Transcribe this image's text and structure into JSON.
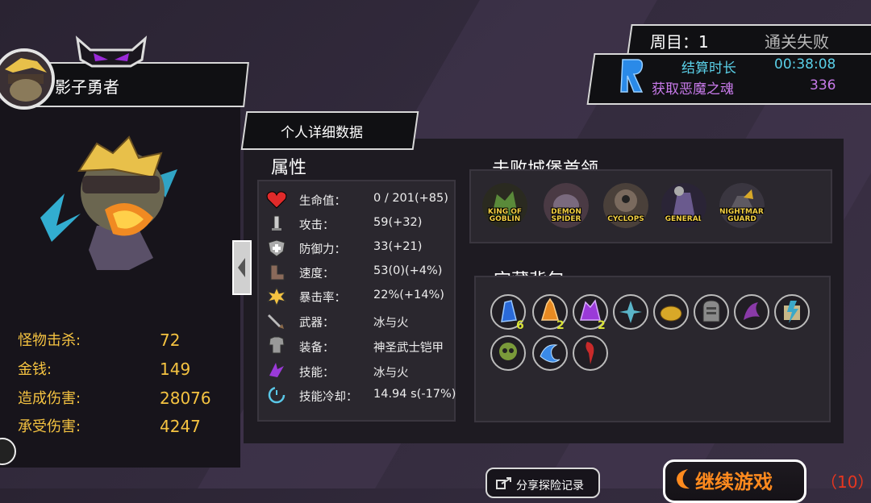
{
  "hero": {
    "name": "影子勇者",
    "stats": [
      {
        "label": "怪物击杀:",
        "value": "72"
      },
      {
        "label": "金钱:",
        "value": "149"
      },
      {
        "label": "造成伤害:",
        "value": "28076"
      },
      {
        "label": "承受伤害:",
        "value": "4247"
      }
    ]
  },
  "detail_tab": "个人详细数据",
  "attributes": {
    "title": "属性",
    "rows": [
      {
        "icon": "heart-icon",
        "label": "生命值：",
        "value": "0 / 201(+85)"
      },
      {
        "icon": "sword-icon",
        "label": "攻击：",
        "value": "59(+32)"
      },
      {
        "icon": "shield-icon",
        "label": "防御力：",
        "value": "33(+21)"
      },
      {
        "icon": "boot-icon",
        "label": "速度：",
        "value": "53(0)(+4%)"
      },
      {
        "icon": "burst-icon",
        "label": "暴击率：",
        "value": "22%(+14%)"
      },
      {
        "icon": "weapon-icon",
        "label": "武器：",
        "value": "冰与火"
      },
      {
        "icon": "armor-icon",
        "label": "装备：",
        "value": "神圣武士铠甲"
      },
      {
        "icon": "skill-icon",
        "label": "技能：",
        "value": "冰与火"
      },
      {
        "icon": "cooldown-icon",
        "label": "技能冷却：",
        "value": "14.94 s(-17%)"
      }
    ]
  },
  "bosses": {
    "title": "击败城堡首领",
    "items": [
      {
        "name": "KING OF GOBLIN",
        "color": "#5a8a3a"
      },
      {
        "name": "DEMON SPIDER",
        "color": "#7a6a7e"
      },
      {
        "name": "CYCLOPS",
        "color": "#7a6a5e"
      },
      {
        "name": "GENERAL",
        "color": "#6a5a8e"
      },
      {
        "name": "NIGHTMARE GUARD",
        "color": "#5e5a62"
      }
    ]
  },
  "treasure": {
    "title": "宝藏背包",
    "items": [
      {
        "icon": "blue-crystal-icon",
        "color": "#2a6ad8",
        "count": "6"
      },
      {
        "icon": "orange-crystal-icon",
        "color": "#e88a22",
        "count": "2"
      },
      {
        "icon": "purple-crystal-icon",
        "color": "#9a3ad8",
        "count": "2"
      },
      {
        "icon": "ice-shard-icon",
        "color": "#5ab4c8",
        "count": ""
      },
      {
        "icon": "gold-coin-icon",
        "color": "#d8a828",
        "count": ""
      },
      {
        "icon": "tombstone-icon",
        "color": "#8a8a8a",
        "count": ""
      },
      {
        "icon": "purple-claw-icon",
        "color": "#8a3aa8",
        "count": ""
      },
      {
        "icon": "lightning-scroll-icon",
        "color": "#3aa8c8",
        "count": ""
      },
      {
        "icon": "green-skull-icon",
        "color": "#7a9a3a",
        "count": ""
      },
      {
        "icon": "blue-wave-icon",
        "color": "#3a8ae8",
        "count": ""
      },
      {
        "icon": "red-fang-icon",
        "color": "#c82a2a",
        "count": ""
      }
    ]
  },
  "run": {
    "cycle_label": "周目：1",
    "status": "通关失败",
    "time_label": "结算时长",
    "time_value": "00:38:08",
    "souls_label": "获取恶魔之魂",
    "souls_value": "336"
  },
  "share_label": "分享探险记录",
  "continue_label": "继续游戏",
  "countdown": "（10）"
}
